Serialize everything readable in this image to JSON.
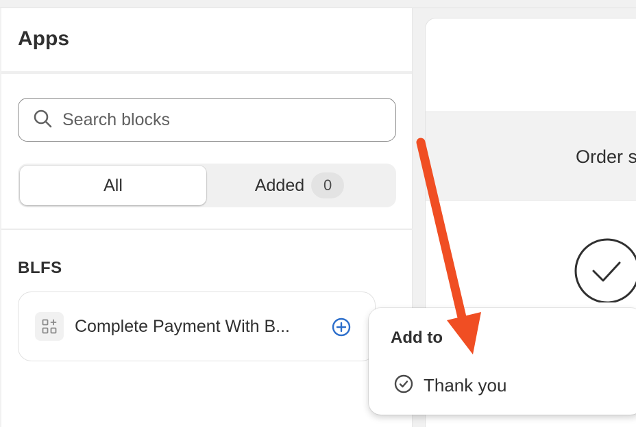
{
  "panel": {
    "title": "Apps"
  },
  "search": {
    "placeholder": "Search blocks",
    "icon": "search-icon"
  },
  "segmented": {
    "tabs": [
      {
        "label": "All",
        "active": true
      },
      {
        "label": "Added",
        "count": "0",
        "active": false
      }
    ]
  },
  "section": {
    "title": "BLFS",
    "apps": [
      {
        "name": "Complete Payment With B...",
        "icon": "app-block-icon",
        "action_icon": "add-circle-icon"
      }
    ]
  },
  "preview": {
    "order_text": "Order s"
  },
  "popover": {
    "title": "Add to",
    "items": [
      {
        "label": "Thank you",
        "icon": "check-circle-icon"
      }
    ]
  },
  "colors": {
    "accent": "#2c6ecb",
    "annotation_arrow": "#f04e23",
    "text": "#303030"
  }
}
